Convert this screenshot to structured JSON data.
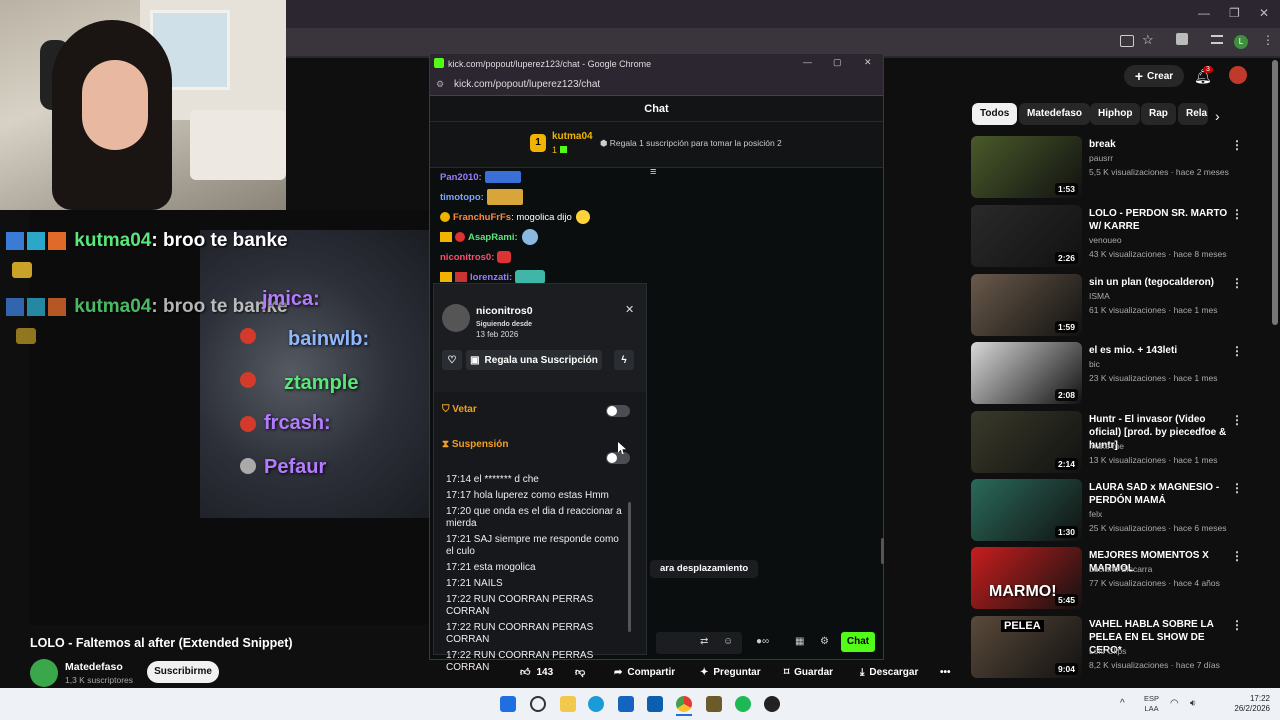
{
  "browser": {
    "window_controls": [
      "—",
      "❐",
      "✕"
    ]
  },
  "yt_header": {
    "create_label": "Crear",
    "notif_count": "3"
  },
  "stream_overlay": {
    "chat1_user": "kutma04",
    "chat1_text": ": broo te banke",
    "chat2_user": "kutma04",
    "chat2_text": ": broo te banke",
    "names": [
      "jmica:",
      "bainwlb:",
      "ztample",
      "frcash:",
      "Pefaur"
    ]
  },
  "popup": {
    "title": "kick.com/popout/luperez123/chat - Google Chrome",
    "url": "kick.com/popout/luperez123/chat",
    "chat_header": "Chat",
    "pinned_user": "kutma04",
    "pinned_rank": "1",
    "pinned_count": "1",
    "pinned_text": "Regala 1 suscripción para tomar la posición 2",
    "messages": [
      {
        "user": "Pan2010:",
        "text": "",
        "color": "#9b7bff"
      },
      {
        "user": "timotopo:",
        "text": "",
        "color": "#7aa6ff"
      },
      {
        "user": "FranchuFrFs",
        "text": ": mogolica dijo",
        "color": "#ff8a3d"
      },
      {
        "user": "AsapRami:",
        "text": "",
        "color": "#59e67a"
      },
      {
        "user": "niconitros0:",
        "text": "",
        "color": "#ff4d6d"
      },
      {
        "user": "lorenzati:",
        "text": "",
        "color": "#9b7bff"
      }
    ],
    "scroll_hint": "ara desplazamiento",
    "chat_button": "Chat"
  },
  "usercard": {
    "username": "niconitros0",
    "following_label": "Siguiendo desde",
    "following_date": "13 feb 2026",
    "gift_button": "Regala una Suscripción",
    "ban_label": "Vetar",
    "timeout_label": "Suspensión",
    "log": [
      "17:14 el ******* d che",
      "17:17 hola luperez como estas Hmm",
      "17:20 que onda es el dia d reaccionar a mierda",
      "17:21 SAJ siempre me responde como el culo",
      "17:21 esta mogolica",
      "17:21 NAILS",
      "17:22 RUN COORRAN PERRAS CORRAN",
      "17:22 RUN COORRAN PERRAS CORRAN",
      "17:22 RUN COORRAN PERRAS CORRAN"
    ]
  },
  "video": {
    "title": "LOLO - Faltemos al after (Extended Snippet)",
    "channel": "Matedefaso",
    "subs": "1,3 K suscriptores",
    "subscribe": "Suscribirme",
    "likes": "143",
    "share": "Compartir",
    "ask": "Preguntar",
    "save": "Guardar",
    "download": "Descargar"
  },
  "chips": [
    "Todos",
    "Matedefaso",
    "Hiphop",
    "Rap",
    "Rela"
  ],
  "recs": [
    {
      "title": "break",
      "channel": "pausrr",
      "views": "5,5 K visualizaciones · hace 2 meses",
      "dur": "1:53",
      "color": "#4a5a2a"
    },
    {
      "title": "LOLO - PERDON SR. MARTO W/ KARRE",
      "channel": "venoueo",
      "views": "43 K visualizaciones · hace 8 meses",
      "dur": "2:26",
      "color": "#2a2a2a"
    },
    {
      "title": "sin un plan (tegocalderon)",
      "channel": "ISMA",
      "views": "61 K visualizaciones · hace 1 mes",
      "dur": "1:59",
      "color": "#6a5a4a"
    },
    {
      "title": "el es mio. + 143leti",
      "channel": "bic",
      "views": "23 K visualizaciones · hace 1 mes",
      "dur": "2:08",
      "color": "#d8d8d8"
    },
    {
      "title": "Huntr - El invasor (Video oficial) [prod. by piecedfoe & huntr]",
      "channel": "make me",
      "views": "13 K visualizaciones · hace 1 mes",
      "dur": "2:14",
      "color": "#3a3a2a"
    },
    {
      "title": "LAURA SAD x MAGNESIO - PERDÓN MAMÁ",
      "channel": "felx",
      "views": "25 K visualizaciones · hace 6 meses",
      "dur": "1:30",
      "color": "#2a6a5a"
    },
    {
      "title": "MEJORES MOMENTOS X MARMOL",
      "channel": "Luciano Biscarra",
      "views": "77 K visualizaciones · hace 4 años",
      "dur": "5:45",
      "color": "#c81e1e"
    },
    {
      "title": "VAHEL HABLA SOBRE LA PELEA EN EL SHOW DE CERO*",
      "channel": "Lolo Clips",
      "views": "8,2 K visualizaciones · hace 7 días",
      "dur": "9:04",
      "color": "#5a4a3a"
    }
  ],
  "rec_overlay": {
    "marmo": "MARMO!",
    "pelea": "PELEA"
  },
  "taskbar": {
    "lang": "ESP",
    "lang2": "LAA",
    "time": "17:22",
    "date": "26/2/2026"
  }
}
